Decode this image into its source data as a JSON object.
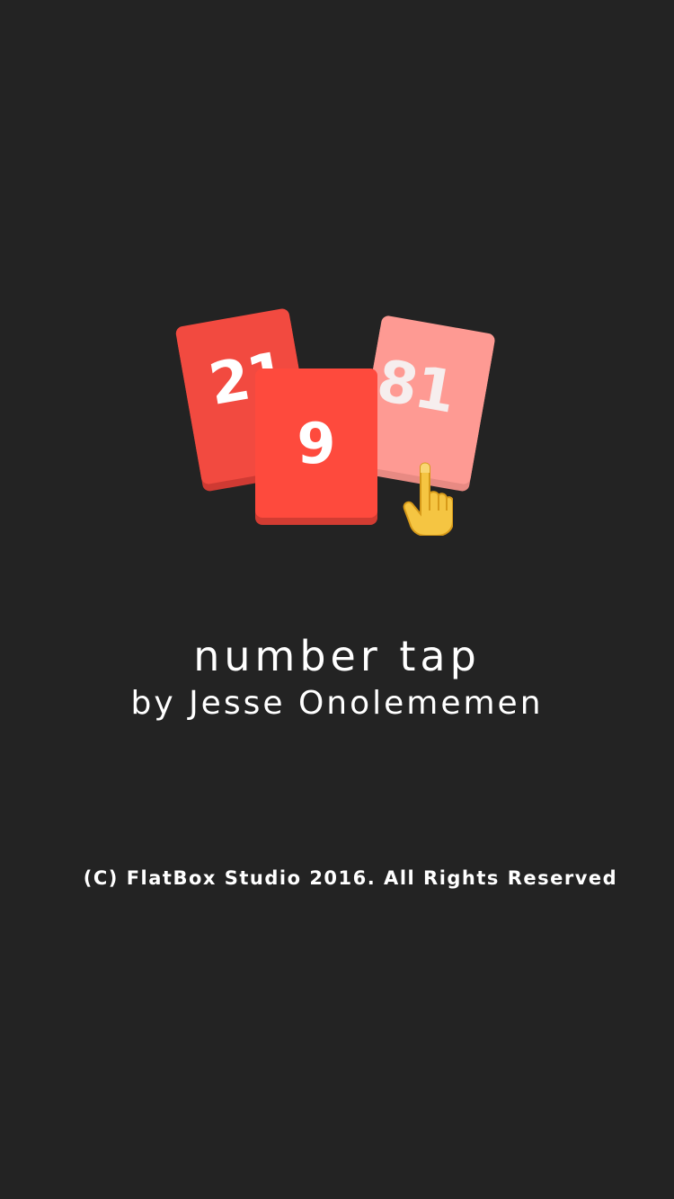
{
  "app": {
    "title": "number tap",
    "author_line": "by Jesse Onolememen",
    "copyright": "(C) FlatBox Studio 2016. All Rights Reserved"
  },
  "logo": {
    "cards": [
      {
        "number": "21",
        "color": "#f24a40"
      },
      {
        "number": "9",
        "color": "#fe4a3d"
      },
      {
        "number": "81",
        "color": "#fe9a93"
      }
    ],
    "pointer_icon": "pointing-hand-icon"
  },
  "colors": {
    "background": "#232323",
    "text": "#ffffff"
  }
}
